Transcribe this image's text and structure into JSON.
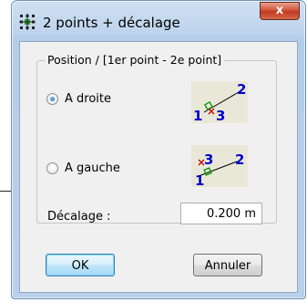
{
  "window": {
    "title": "2 points + décalage",
    "close_label": "x"
  },
  "group": {
    "title": "Position / [1er point - 2e point]",
    "options": [
      {
        "label": "A droite",
        "checked": true,
        "illustration": {
          "p1": "1",
          "p2": "2",
          "p3": "3"
        }
      },
      {
        "label": "A gauche",
        "checked": false,
        "illustration": {
          "p1": "1",
          "p2": "2",
          "p3": "3"
        }
      }
    ]
  },
  "offset": {
    "label": "Décalage :",
    "value": "0.200 m"
  },
  "buttons": {
    "ok": "OK",
    "cancel": "Annuler"
  },
  "colors": {
    "illustration_bg": "#e9e8d8",
    "point_number": "#0000cc",
    "cross_marker": "#cc0000",
    "right_angle": "#009900"
  }
}
